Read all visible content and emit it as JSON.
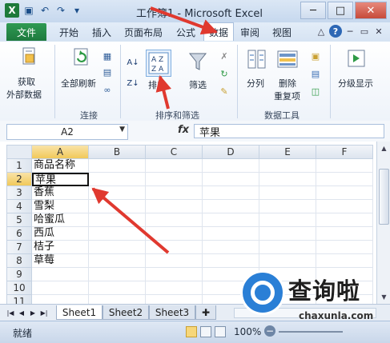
{
  "window": {
    "title": "工作簿1 - Microsoft Excel",
    "buttons": {
      "minimize": "─",
      "maximize": "□",
      "close": "✕"
    }
  },
  "ribbon_tabs": {
    "file": "文件",
    "items": [
      "开始",
      "插入",
      "页面布局",
      "公式",
      "数据",
      "审阅",
      "视图"
    ],
    "active": "数据"
  },
  "ribbon": {
    "get_external_data": {
      "line1": "获取",
      "line2": "外部数据"
    },
    "refresh_all": "全部刷新",
    "connections_group": "连接",
    "sort": "排序",
    "filter": "筛选",
    "sort_filter_group": "排序和筛选",
    "text_to_columns": "分列",
    "remove_duplicates": {
      "line1": "删除",
      "line2": "重复项"
    },
    "data_tools_group": "数据工具",
    "outline": "分级显示"
  },
  "formula_bar": {
    "name_box": "A2",
    "fx": "fx",
    "content": "苹果"
  },
  "sheet": {
    "columns": [
      "A",
      "B",
      "C",
      "D",
      "E",
      "F"
    ],
    "rows": [
      "1",
      "2",
      "3",
      "4",
      "5",
      "6",
      "7",
      "8",
      "9",
      "10",
      "11"
    ],
    "column_a_values": [
      "商品名称",
      "苹果",
      "香蕉",
      "雪梨",
      "哈蜜瓜",
      "西瓜",
      "桔子",
      "草莓",
      "",
      "",
      ""
    ],
    "active_cell": "A2"
  },
  "sheet_tabs": [
    "Sheet1",
    "Sheet2",
    "Sheet3"
  ],
  "status_bar": {
    "ready": "就绪",
    "zoom": "100%"
  },
  "watermark": {
    "text": "查询啦",
    "url": "chaxunla.com"
  },
  "colors": {
    "file_tab": "#1e7a3a",
    "arrow": "#e0392f",
    "selection_header": "#f1c95a"
  }
}
